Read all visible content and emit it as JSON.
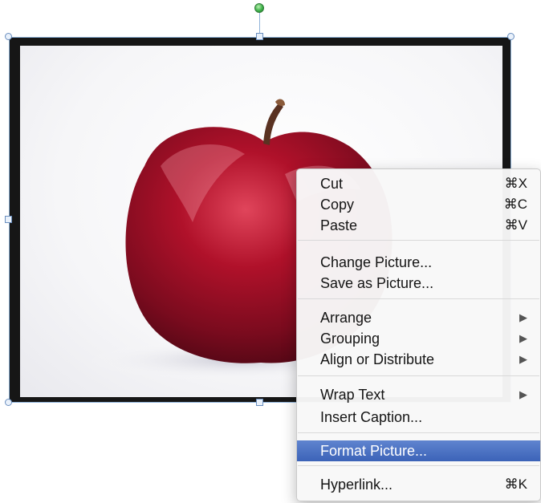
{
  "context_menu": {
    "items": [
      {
        "label": "Cut",
        "shortcut": "⌘X"
      },
      {
        "label": "Copy",
        "shortcut": "⌘C"
      },
      {
        "label": "Paste",
        "shortcut": "⌘V"
      },
      {
        "label": "Change Picture..."
      },
      {
        "label": "Save as Picture..."
      },
      {
        "label": "Arrange",
        "submenu": true
      },
      {
        "label": "Grouping",
        "submenu": true
      },
      {
        "label": "Align or Distribute",
        "submenu": true
      },
      {
        "label": "Wrap Text",
        "submenu": true
      },
      {
        "label": "Insert Caption..."
      },
      {
        "label": "Format Picture...",
        "highlighted": true
      },
      {
        "label": "Hyperlink...",
        "shortcut": "⌘K"
      }
    ],
    "submenu_arrow": "▶"
  },
  "picture": {
    "subject": "red apple",
    "frame_color": "#161616"
  },
  "colors": {
    "highlight": "#3c63b8",
    "selection": "#8fb3d9"
  }
}
